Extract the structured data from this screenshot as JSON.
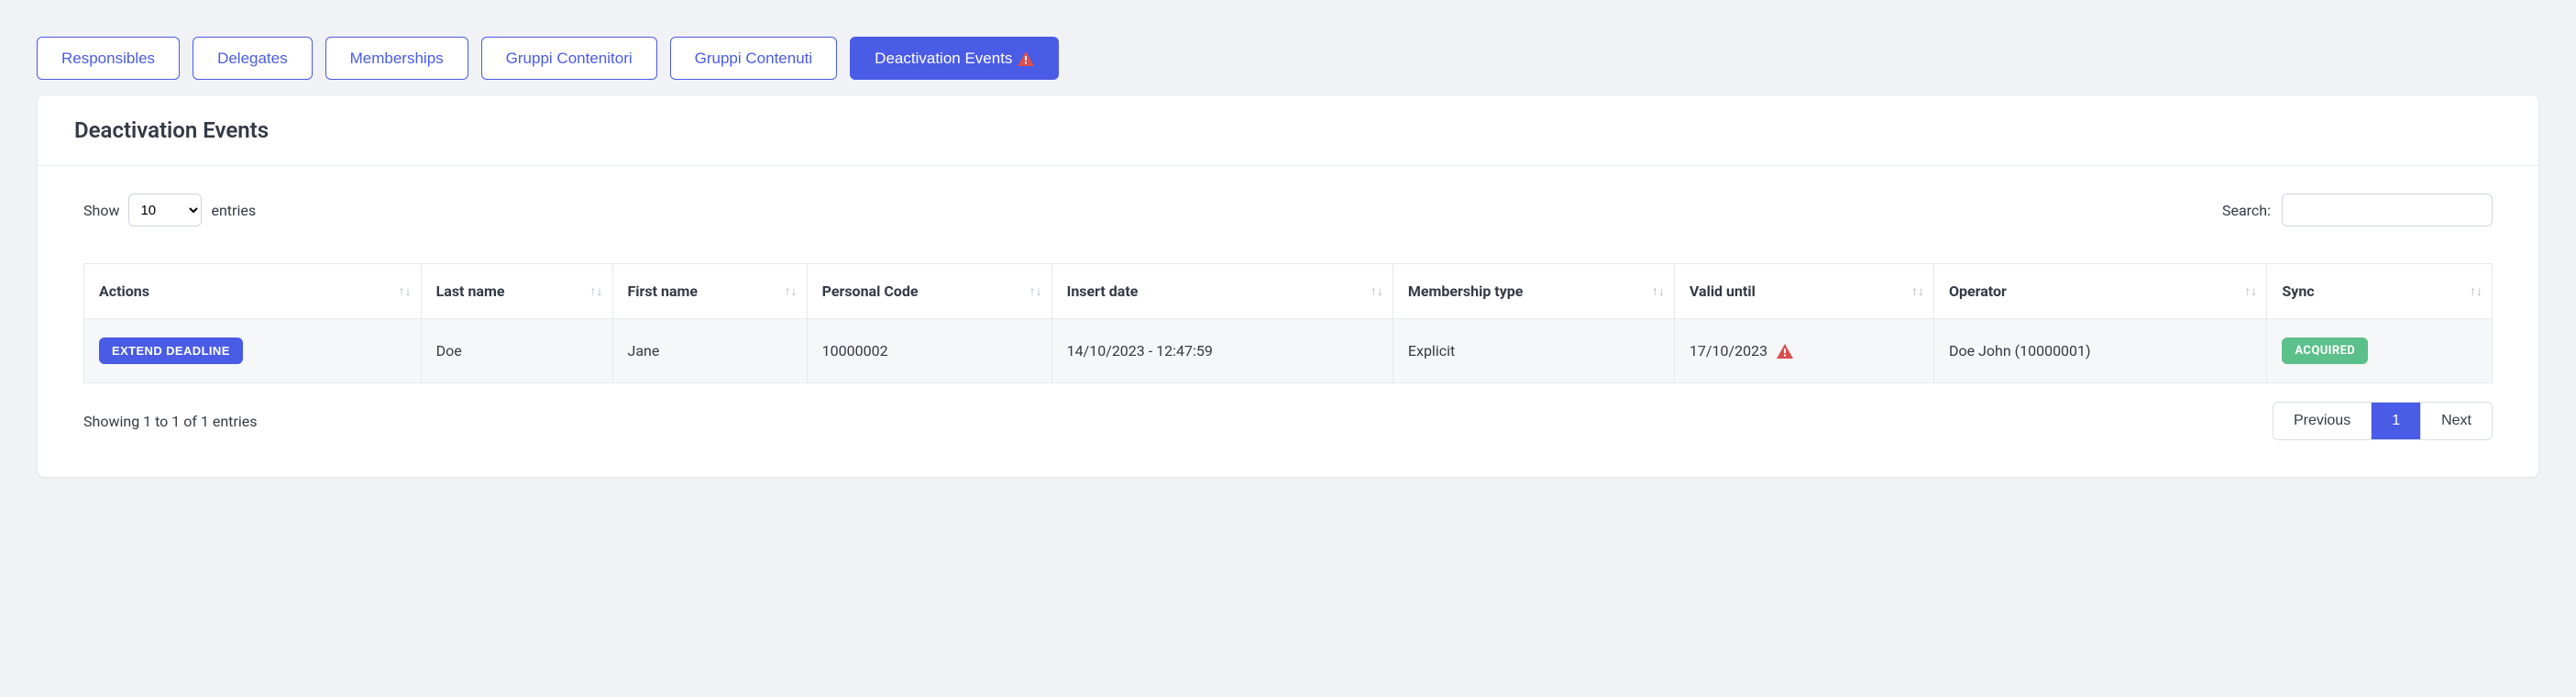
{
  "tabs": [
    {
      "label": "Responsibles",
      "active": false,
      "has_warning": false
    },
    {
      "label": "Delegates",
      "active": false,
      "has_warning": false
    },
    {
      "label": "Memberships",
      "active": false,
      "has_warning": false
    },
    {
      "label": "Gruppi Contenitori",
      "active": false,
      "has_warning": false
    },
    {
      "label": "Gruppi Contenuti",
      "active": false,
      "has_warning": false
    },
    {
      "label": "Deactivation Events",
      "active": true,
      "has_warning": true
    }
  ],
  "panel": {
    "title": "Deactivation Events"
  },
  "controls": {
    "show_label_before": "Show",
    "show_label_after": "entries",
    "page_size_options": [
      "10"
    ],
    "page_size_selected": "10",
    "search_label": "Search:",
    "search_value": ""
  },
  "columns": [
    {
      "label": "Actions"
    },
    {
      "label": "Last name"
    },
    {
      "label": "First name"
    },
    {
      "label": "Personal Code"
    },
    {
      "label": "Insert date"
    },
    {
      "label": "Membership type"
    },
    {
      "label": "Valid until"
    },
    {
      "label": "Operator"
    },
    {
      "label": "Sync"
    }
  ],
  "rows": [
    {
      "action_label": "EXTEND DEADLINE",
      "last_name": "Doe",
      "first_name": "Jane",
      "personal_code": "10000002",
      "insert_date": "14/10/2023 - 12:47:59",
      "membership_type": "Explicit",
      "valid_until": "17/10/2023",
      "valid_until_warning": true,
      "operator": "Doe John (10000001)",
      "sync_label": "ACQUIRED"
    }
  ],
  "footer": {
    "showing_text": "Showing 1 to 1 of 1 entries",
    "prev_label": "Previous",
    "next_label": "Next",
    "pages": [
      {
        "label": "1",
        "active": true
      }
    ]
  },
  "colors": {
    "accent": "#4a5be6",
    "warning": "#d94f4f",
    "success": "#5bc08a"
  }
}
